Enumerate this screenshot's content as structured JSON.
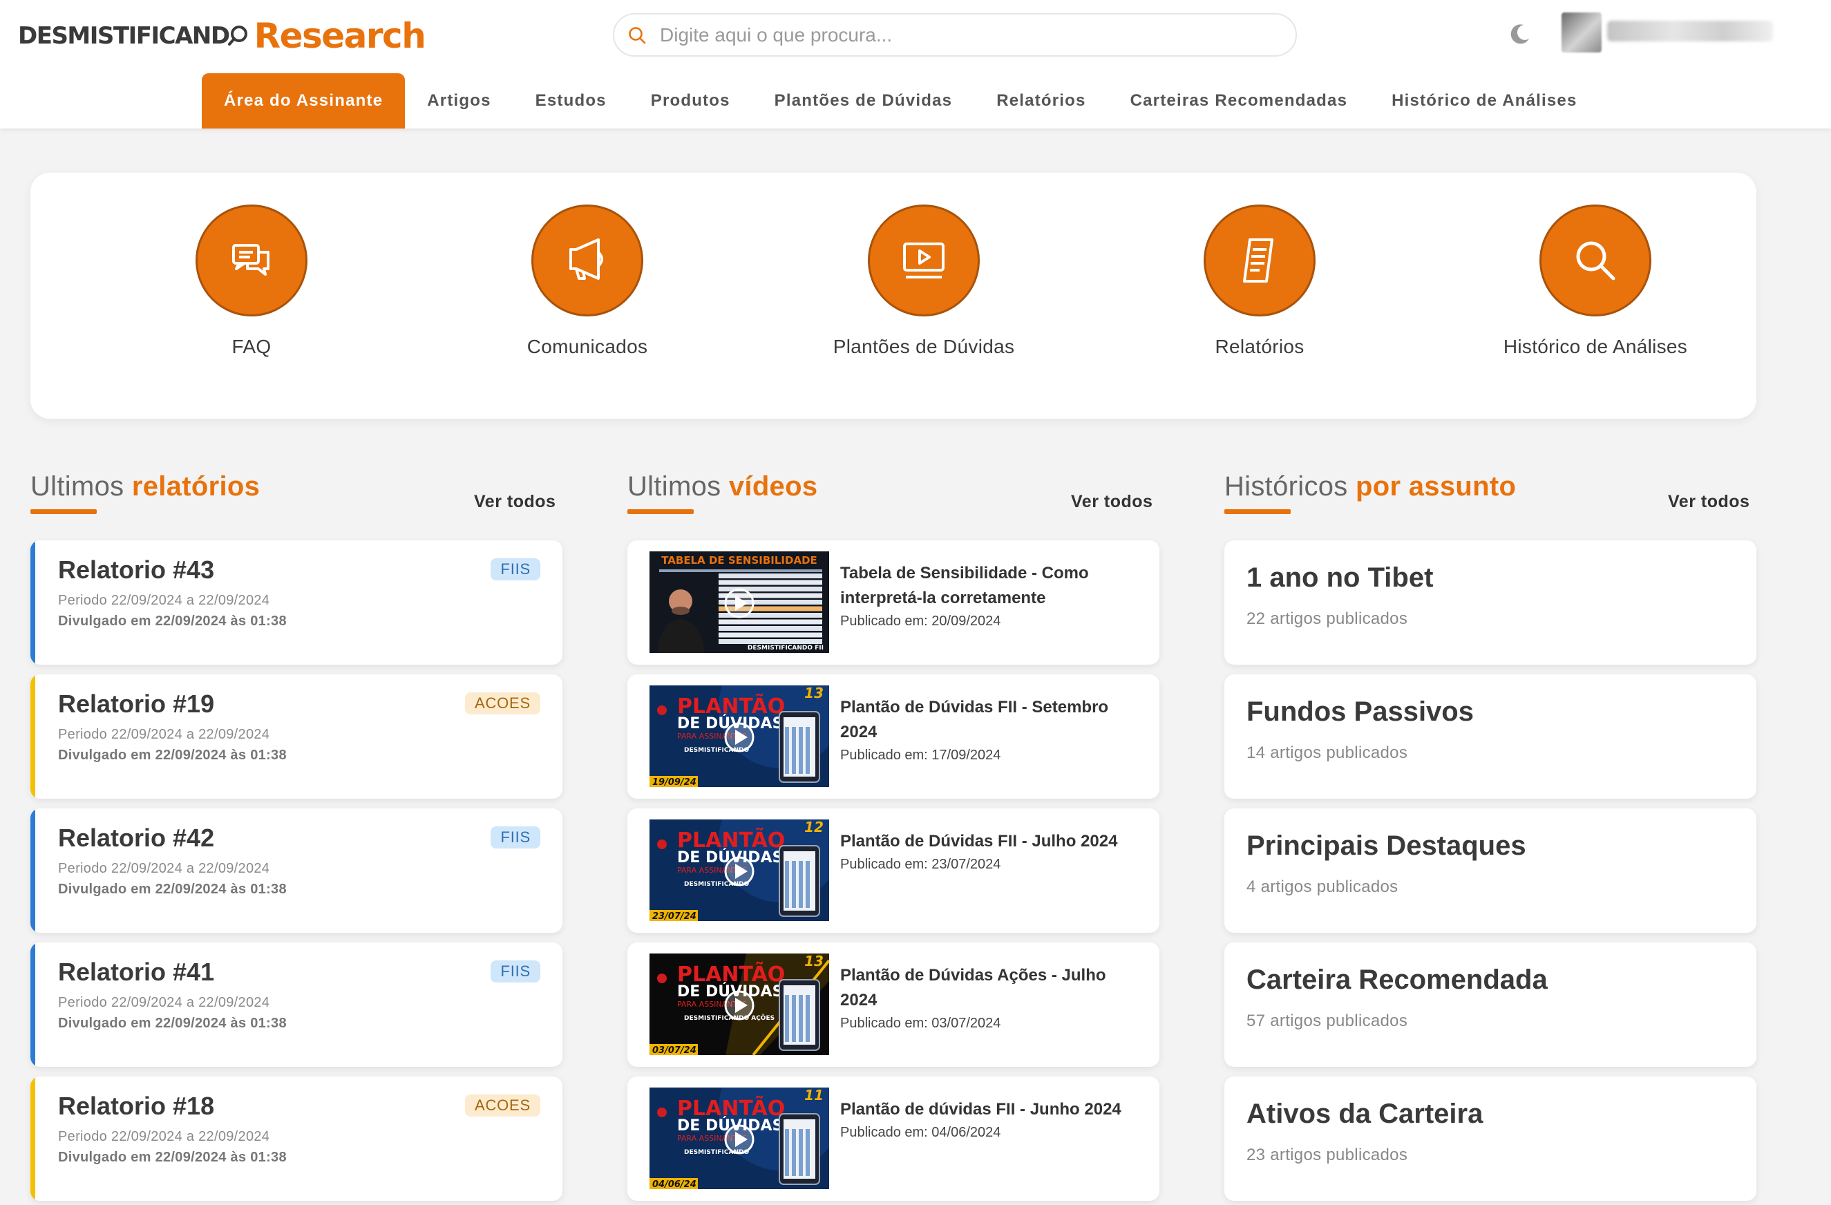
{
  "brand": {
    "part1": "DESMISTIFICAND",
    "part2": "Research"
  },
  "search": {
    "placeholder": "Digite aqui o que procura..."
  },
  "nav": [
    {
      "label": "Área do Assinante",
      "active": true
    },
    {
      "label": "Artigos"
    },
    {
      "label": "Estudos"
    },
    {
      "label": "Produtos"
    },
    {
      "label": "Plantões de Dúvidas"
    },
    {
      "label": "Relatórios"
    },
    {
      "label": "Carteiras Recomendadas"
    },
    {
      "label": "Histórico de Análises"
    }
  ],
  "quick": [
    {
      "label": "FAQ",
      "icon": "chat-bubbles-icon"
    },
    {
      "label": "Comunicados",
      "icon": "megaphone-icon"
    },
    {
      "label": "Plantões de Dúvidas",
      "icon": "video-player-icon"
    },
    {
      "label": "Relatórios",
      "icon": "document-icon"
    },
    {
      "label": "Histórico de Análises",
      "icon": "search-icon"
    }
  ],
  "sections": {
    "reports": {
      "prefix": "Ultimos ",
      "highlight": "relatórios",
      "more": "Ver todos"
    },
    "videos": {
      "prefix": "Ultimos ",
      "highlight": "vídeos",
      "more": "Ver todos"
    },
    "history": {
      "prefix": "Históricos ",
      "highlight": "por assunto",
      "more": "Ver todos"
    }
  },
  "reports": [
    {
      "title": "Relatorio #43",
      "period": "Periodo 22/09/2024 a 22/09/2024",
      "released": "Divulgado em 22/09/2024 às 01:38",
      "tag": "FIIS"
    },
    {
      "title": "Relatorio #19",
      "period": "Periodo 22/09/2024 a 22/09/2024",
      "released": "Divulgado em 22/09/2024 às 01:38",
      "tag": "ACOES"
    },
    {
      "title": "Relatorio #42",
      "period": "Periodo 22/09/2024 a 22/09/2024",
      "released": "Divulgado em 22/09/2024 às 01:38",
      "tag": "FIIS"
    },
    {
      "title": "Relatorio #41",
      "period": "Periodo 22/09/2024 a 22/09/2024",
      "released": "Divulgado em 22/09/2024 às 01:38",
      "tag": "FIIS"
    },
    {
      "title": "Relatorio #18",
      "period": "Periodo 22/09/2024 a 22/09/2024",
      "released": "Divulgado em 22/09/2024 às 01:38",
      "tag": "ACOES"
    }
  ],
  "tag_colors": {
    "FIIS": {
      "bar": "#2b7cd3",
      "bg": "#cfe6fb",
      "fg": "#2f6fb3"
    },
    "ACOES": {
      "bar": "#f2c200",
      "bg": "#fdebcf",
      "fg": "#a5660e"
    }
  },
  "videos": [
    {
      "title": "Tabela de Sensibilidade - Como interpretá-la corretamente",
      "published": "Publicado em: 20/09/2024",
      "thumb": {
        "kind": "table",
        "heading": "TABELA DE SENSIBILIDADE",
        "brand": "DESMISTIFICANDO FII"
      }
    },
    {
      "title": "Plantão de Dúvidas FII - Setembro 2024",
      "published": "Publicado em: 17/09/2024",
      "thumb": {
        "kind": "plantao",
        "l1": "PLANTÃO",
        "l2": "DE DÚVIDAS",
        "l3": "PARA ASSINANTES",
        "brand": "DESMISTIFICANDO",
        "num": "13",
        "date": "19/09/24",
        "theme": "blue"
      }
    },
    {
      "title": "Plantão de Dúvidas FII - Julho 2024",
      "published": "Publicado em: 23/07/2024",
      "thumb": {
        "kind": "plantao",
        "l1": "PLANTÃO",
        "l2": "DE DÚVIDAS",
        "l3": "PARA ASSINANTES",
        "brand": "DESMISTIFICANDO",
        "num": "12",
        "date": "23/07/24",
        "theme": "blue"
      }
    },
    {
      "title": "Plantão de Dúvidas Ações - Julho 2024",
      "published": "Publicado em: 03/07/2024",
      "thumb": {
        "kind": "plantao",
        "l1": "PLANTÃO",
        "l2": "DE DÚVIDAS",
        "l3": "PARA ASSINANTES",
        "brand": "DESMISTIFICANDO AÇÕES",
        "num": "13",
        "date": "03/07/24",
        "theme": "gold"
      }
    },
    {
      "title": "Plantão de dúvidas FII - Junho 2024",
      "published": "Publicado em: 04/06/2024",
      "thumb": {
        "kind": "plantao",
        "l1": "PLANTÃO",
        "l2": "DE DÚVIDAS",
        "l3": "PARA ASSINANTES",
        "brand": "DESMISTIFICANDO",
        "num": "11",
        "date": "04/06/24",
        "theme": "blue"
      }
    }
  ],
  "history": [
    {
      "title": "1 ano no Tibet",
      "count": "22 artigos publicados"
    },
    {
      "title": "Fundos Passivos",
      "count": "14 artigos publicados"
    },
    {
      "title": "Principais Destaques",
      "count": "4 artigos publicados"
    },
    {
      "title": "Carteira Recomendada",
      "count": "57 artigos publicados"
    },
    {
      "title": "Ativos da Carteira",
      "count": "23 artigos publicados"
    }
  ],
  "colors": {
    "accent": "#e8720c",
    "background": "#f3f3f4"
  }
}
